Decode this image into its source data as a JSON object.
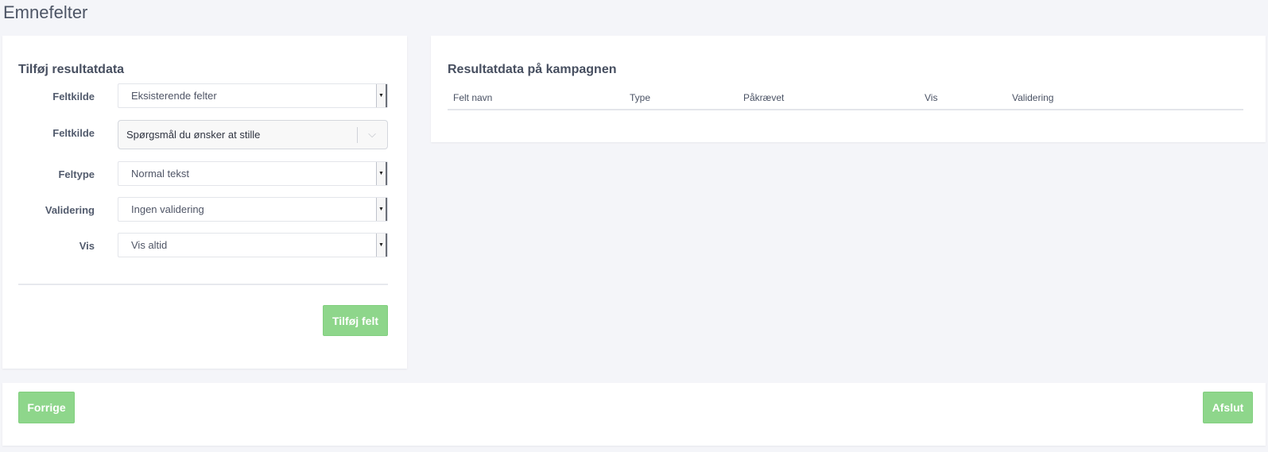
{
  "page": {
    "title": "Emnefelter"
  },
  "left_card": {
    "title": "Tilføj resultatdata",
    "rows": [
      {
        "label": "Feltkilde",
        "value": "Eksisterende felter"
      },
      {
        "label": "Feltkilde",
        "value": "Spørgsmål du ønsker at stille"
      },
      {
        "label": "Feltype",
        "value": "Normal tekst"
      },
      {
        "label": "Validering",
        "value": "Ingen validering"
      },
      {
        "label": "Vis",
        "value": "Vis altid"
      }
    ],
    "add_button": "Tilføj felt"
  },
  "right_card": {
    "title": "Resultatdata på kampagnen",
    "columns": [
      "Felt navn",
      "Type",
      "Påkrævet",
      "Vis",
      "Validering"
    ]
  },
  "footer": {
    "prev_button": "Forrige",
    "finish_button": "Afslut"
  },
  "colors": {
    "background": "#f4f5f9",
    "button_green": "#8ed68b",
    "text": "#4a5264"
  }
}
